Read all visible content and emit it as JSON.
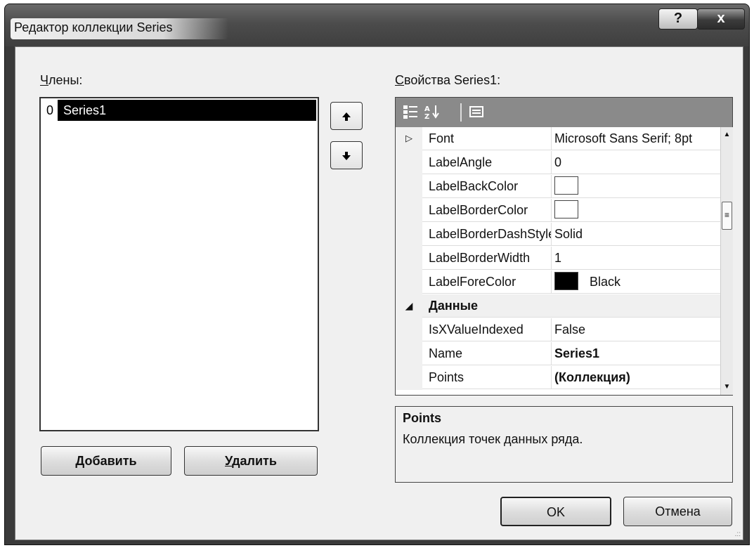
{
  "window": {
    "title": "Редактор коллекции Series",
    "help_label": "?",
    "close_label": "x"
  },
  "members": {
    "label_accel": "Ч",
    "label_rest": "лены:",
    "items": [
      {
        "index": "0",
        "name": "Series1"
      }
    ],
    "move_up_icon": "arrow-up-icon",
    "move_down_icon": "arrow-down-icon"
  },
  "buttons": {
    "add_accel": "Д",
    "add_rest": "обавить",
    "remove_accel": "У",
    "remove_rest": "далить",
    "ok": "OK",
    "cancel": "Отмена"
  },
  "properties": {
    "label_accel": "С",
    "label_rest": "войства Series1:",
    "toolbar": {
      "categorized_icon": "categorized-icon",
      "alphabetical_icon": "alphabetical-sort-icon",
      "property_pages_icon": "property-pages-icon"
    },
    "rows": [
      {
        "name": "Font",
        "value": "Microsoft Sans Serif; 8pt",
        "expander": "▷"
      },
      {
        "name": "LabelAngle",
        "value": "0"
      },
      {
        "name": "LabelBackColor",
        "value": "",
        "swatch": "#ffffff"
      },
      {
        "name": "LabelBorderColor",
        "value": "",
        "swatch": "#ffffff"
      },
      {
        "name": "LabelBorderDashStyle",
        "value": "Solid"
      },
      {
        "name": "LabelBorderWidth",
        "value": "1"
      },
      {
        "name": "LabelForeColor",
        "value": "Black",
        "swatch": "#000000"
      }
    ],
    "category": {
      "name": "Данные",
      "expander": "◢"
    },
    "rows2": [
      {
        "name": "IsXValueIndexed",
        "value": "False"
      },
      {
        "name": "Name",
        "value": "Series1",
        "bold": true
      },
      {
        "name": "Points",
        "value": "(Коллекция)",
        "bold": true
      }
    ]
  },
  "description": {
    "title": "Points",
    "text": "Коллекция точек данных ряда."
  }
}
